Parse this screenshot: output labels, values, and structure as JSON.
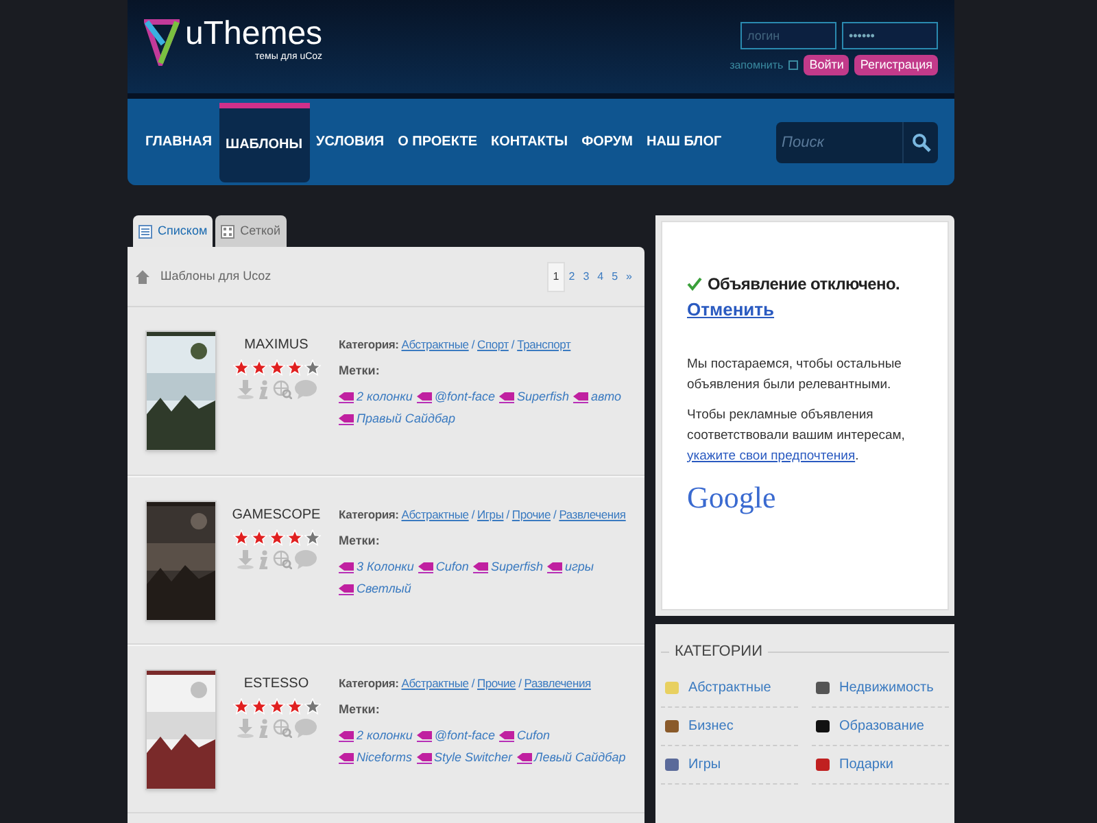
{
  "header": {
    "logo": "uThemes",
    "tagline": "темы для uCoz",
    "login_placeholder": "логин",
    "password_value": "••••••",
    "remember": {
      "label": "запомнить",
      "checked": false
    },
    "buttons": [
      "Войти",
      "Регистрация"
    ]
  },
  "nav": [
    {
      "label": "ГЛАВНАЯ",
      "selected": false
    },
    {
      "label": "ШАБЛОНЫ",
      "selected": true
    },
    {
      "label": "УСЛОВИЯ",
      "selected": false
    },
    {
      "label": "О ПРОЕКТЕ",
      "selected": false
    },
    {
      "label": "КОНТАКТЫ",
      "selected": false
    },
    {
      "label": "ФОРУМ",
      "selected": false
    },
    {
      "label": "НАШ БЛОГ",
      "selected": false
    }
  ],
  "search": {
    "placeholder": "Поиск"
  },
  "view_tabs": [
    {
      "label": "Списком",
      "selected": true
    },
    {
      "label": "Сеткой",
      "selected": false
    }
  ],
  "breadcrumb": "Шаблоны для Ucoz",
  "pagination": [
    {
      "label": "1",
      "selected": true
    },
    {
      "label": "2",
      "selected": false
    },
    {
      "label": "3",
      "selected": false
    },
    {
      "label": "4",
      "selected": false
    },
    {
      "label": "5",
      "selected": false
    },
    {
      "label": "»",
      "selected": false
    }
  ],
  "templates": [
    {
      "name": "MAXIMUS",
      "stars": 4,
      "category_label": "Категория:",
      "separator": "/",
      "categories": [
        "Абстрактные",
        "Спорт",
        "Транспорт"
      ],
      "tags_label": "Метки:",
      "tags": [
        "2 колонки",
        "@font-face",
        "Superfish",
        "авто",
        "Правый Сайдбар"
      ]
    },
    {
      "name": "GAMESCOPE",
      "stars": 4,
      "category_label": "Категория:",
      "separator": "/",
      "categories": [
        "Абстрактные",
        "Игры",
        "Прочие",
        "Развлечения"
      ],
      "tags_label": "Метки:",
      "tags": [
        "3 Колонки",
        "Cufon",
        "Superfish",
        "игры",
        "Светлый"
      ]
    },
    {
      "name": "ESTESSO",
      "stars": 4,
      "category_label": "Категория:",
      "separator": "/",
      "categories": [
        "Абстрактные",
        "Прочие",
        "Развлечения"
      ],
      "tags_label": "Метки:",
      "tags": [
        "2 колонки",
        "@font-face",
        "Cufon",
        "Niceforms",
        "Style Switcher",
        "Левый Сайдбар"
      ]
    }
  ],
  "ad": {
    "title": "Объявление отключено.",
    "undo": "Отменить",
    "text1": "Мы постараемся, чтобы остальные объявления были релевантными.",
    "text2": "Чтобы рекламные объявления соответствовали вашим интересам,",
    "link": "укажите свои предпочтения",
    "link_end": ".",
    "brand": "Google"
  },
  "categories": {
    "title": "КАТЕГОРИИ",
    "items": [
      "Абстрактные",
      "Недвижимость",
      "Бизнес",
      "Образование",
      "Игры",
      "Подарки"
    ]
  }
}
